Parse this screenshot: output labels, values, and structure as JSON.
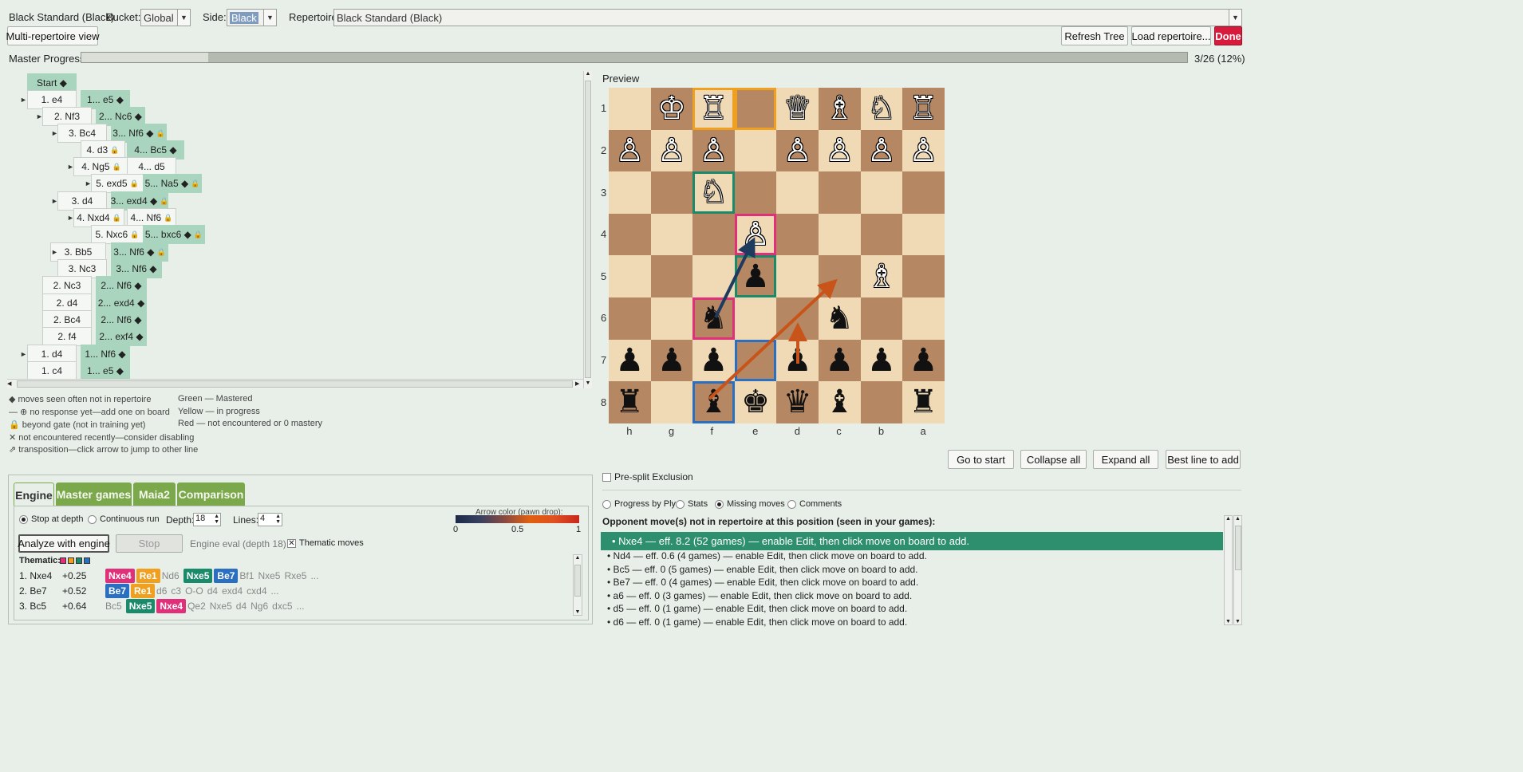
{
  "header": {
    "repertoire_name": "Black Standard (Black)",
    "bucket_label": "Bucket:",
    "bucket_value": "Global",
    "side_label": "Side:",
    "side_value": "Black",
    "repertoire_label": "Repertoire:",
    "repertoire_value": "Black Standard (Black)"
  },
  "toolbar": {
    "multi_view": "Multi-repertoire view",
    "refresh": "Refresh Tree",
    "load": "Load repertoire...",
    "done": "Done"
  },
  "progress": {
    "label": "Master Progress:",
    "text": "3/26 (12%)",
    "fraction": 0.115
  },
  "tree": [
    {
      "label": "Start ◆",
      "kind": "b"
    },
    {
      "label": "1. e4",
      "kind": "w",
      "toggle": true
    },
    {
      "label": "1... e5 ◆",
      "kind": "b"
    },
    {
      "label": "2. Nf3",
      "kind": "w",
      "toggle": true
    },
    {
      "label": "2... Nc6 ◆",
      "kind": "b"
    },
    {
      "label": "3. Bc4",
      "kind": "w",
      "toggle": true
    },
    {
      "label": "3... Nf6 ◆",
      "kind": "b",
      "lock": true
    },
    {
      "label": "4. d3",
      "kind": "w",
      "lock": true
    },
    {
      "label": "4... Bc5 ◆",
      "kind": "b"
    },
    {
      "label": "4. Ng5",
      "kind": "w",
      "lock": true,
      "toggle": true
    },
    {
      "label": "4... d5",
      "kind": "w"
    },
    {
      "label": "5. exd5",
      "kind": "w",
      "lock": true,
      "toggle": true
    },
    {
      "label": "5... Na5 ◆",
      "kind": "b",
      "lock": true
    },
    {
      "label": "3. d4",
      "kind": "w",
      "toggle": true
    },
    {
      "label": "3... exd4 ◆",
      "kind": "b",
      "lock": true
    },
    {
      "label": "4. Nxd4",
      "kind": "w",
      "lock": true,
      "toggle": true
    },
    {
      "label": "4... Nf6",
      "kind": "w",
      "lock": true
    },
    {
      "label": "5. Nxc6",
      "kind": "w",
      "lock": true
    },
    {
      "label": "5... bxc6 ◆",
      "kind": "b",
      "lock": true
    },
    {
      "label": "3. Bb5",
      "kind": "w",
      "toggle": true
    },
    {
      "label": "3... Nf6 ◆",
      "kind": "b",
      "lock": true
    },
    {
      "label": "3. Nc3",
      "kind": "w"
    },
    {
      "label": "3... Nf6 ◆",
      "kind": "b"
    },
    {
      "label": "2. Nc3",
      "kind": "w"
    },
    {
      "label": "2... Nf6 ◆",
      "kind": "b"
    },
    {
      "label": "2. d4",
      "kind": "w"
    },
    {
      "label": "2... exd4 ◆",
      "kind": "b"
    },
    {
      "label": "2. Bc4",
      "kind": "w"
    },
    {
      "label": "2... Nf6 ◆",
      "kind": "b"
    },
    {
      "label": "2. f4",
      "kind": "w"
    },
    {
      "label": "2... exf4 ◆",
      "kind": "b"
    },
    {
      "label": "1. d4",
      "kind": "w",
      "toggle": true
    },
    {
      "label": "1... Nf6 ◆",
      "kind": "b"
    },
    {
      "label": "1. c4",
      "kind": "w"
    },
    {
      "label": "1... e5 ◆",
      "kind": "b"
    }
  ],
  "legend": {
    "left": [
      "◆ moves seen often not in repertoire",
      "— ⊕  no response yet—add one on board",
      "🔒 beyond gate (not in training yet)",
      "✕ not encountered recently—consider disabling",
      "⇗ transposition—click arrow to jump to other line"
    ],
    "right": [
      "Green — Mastered",
      "Yellow — in progress",
      "Red — not encountered or 0 mastery"
    ]
  },
  "preview": {
    "title": "Preview",
    "files": [
      "h",
      "g",
      "f",
      "e",
      "d",
      "c",
      "b",
      "a"
    ],
    "ranks": [
      "1",
      "2",
      "3",
      "4",
      "5",
      "6",
      "7",
      "8"
    ],
    "pieces": [
      [
        "",
        "♔",
        "♖",
        "",
        "♕",
        "♗",
        "♘",
        "♖"
      ],
      [
        "♙",
        "♙",
        "♙",
        "",
        "♙",
        "♙",
        "♙",
        "♙"
      ],
      [
        "",
        "",
        "♘",
        "",
        "",
        "",
        "",
        ""
      ],
      [
        "",
        "",
        "",
        "♙",
        "",
        "",
        "",
        ""
      ],
      [
        "",
        "",
        "",
        "♟",
        "",
        "",
        "♗",
        ""
      ],
      [
        "",
        "",
        "♞",
        "",
        "",
        "♞",
        "",
        ""
      ],
      [
        "♟",
        "♟",
        "♟",
        "",
        "♟",
        "♟",
        "♟",
        "♟"
      ],
      [
        "♜",
        "",
        "♝",
        "♚",
        "♛",
        "♝",
        "",
        "♜"
      ]
    ],
    "highlights": [
      {
        "file": 2,
        "rank": 0,
        "color": "#f0a020"
      },
      {
        "file": 3,
        "rank": 0,
        "color": "#f0a020"
      },
      {
        "file": 2,
        "rank": 2,
        "color": "#1a8a6a"
      },
      {
        "file": 3,
        "rank": 3,
        "color": "#e0307a"
      },
      {
        "file": 3,
        "rank": 4,
        "color": "#1a8a6a"
      },
      {
        "file": 2,
        "rank": 5,
        "color": "#e0307a"
      },
      {
        "file": 3,
        "rank": 6,
        "color": "#2a6fc0"
      },
      {
        "file": 2,
        "rank": 7,
        "color": "#2a6fc0"
      }
    ]
  },
  "board_buttons": {
    "go_start": "Go to start",
    "collapse": "Collapse all",
    "expand": "Expand all",
    "best_line": "Best line to add"
  },
  "pre_split": "Pre-split Exclusion",
  "tabs": [
    "Engine",
    "Master games",
    "Maia2",
    "Comparison"
  ],
  "engine": {
    "stop_at_depth": "Stop at depth",
    "continuous": "Continuous run",
    "depth_label": "Depth:",
    "depth_value": "18",
    "lines_label": "Lines:",
    "lines_value": "4",
    "arrow_color_label": "Arrow color (pawn drop):",
    "scale": [
      "0",
      "0.5",
      "1"
    ],
    "analyze": "Analyze with engine",
    "stop": "Stop",
    "eval_text": "Engine eval (depth 18)",
    "thematic_label": "Thematic moves",
    "thematic_title": "Thematic:",
    "lines": [
      {
        "move": "1. Nxe4",
        "eval": "+0.25",
        "tokens": [
          [
            "Nxe4",
            "#e0307a"
          ],
          [
            "Re1",
            "#f0a020"
          ],
          [
            "Nd6",
            ""
          ],
          [
            "Nxe5",
            "#1a8a6a"
          ],
          [
            "Be7",
            "#2a6fc0"
          ],
          [
            "Bf1",
            ""
          ],
          [
            "Nxe5",
            ""
          ],
          [
            "Rxe5",
            ""
          ],
          [
            "...",
            ""
          ]
        ]
      },
      {
        "move": "2. Be7",
        "eval": "+0.52",
        "tokens": [
          [
            "Be7",
            "#2a6fc0"
          ],
          [
            "Re1",
            "#f0a020"
          ],
          [
            "d6",
            ""
          ],
          [
            "c3",
            ""
          ],
          [
            "O-O",
            ""
          ],
          [
            "d4",
            ""
          ],
          [
            "exd4",
            ""
          ],
          [
            "cxd4",
            ""
          ],
          [
            "...",
            ""
          ]
        ]
      },
      {
        "move": "3. Bc5",
        "eval": "+0.64",
        "tokens": [
          [
            "Bc5",
            ""
          ],
          [
            "Nxe5",
            "#1a8a6a"
          ],
          [
            "Nxe4",
            "#e0307a"
          ],
          [
            "Qe2",
            ""
          ],
          [
            "Nxe5",
            ""
          ],
          [
            "d4",
            ""
          ],
          [
            "Ng6",
            ""
          ],
          [
            "dxc5",
            ""
          ],
          [
            "...",
            ""
          ]
        ]
      }
    ],
    "thematic_colors": [
      "#e0307a",
      "#f0a020",
      "#1a8a6a",
      "#2a6fc0"
    ]
  },
  "right_panel": {
    "radios": [
      "Progress by Ply",
      "Stats",
      "Missing moves",
      "Comments"
    ],
    "selected": 2,
    "heading": "Opponent move(s) not in repertoire at this position (seen in your games):",
    "rows": [
      "• Nxe4 — eff. 8.2 (52 games) — enable Edit, then click move on board to add.",
      "• Nd4 — eff. 0.6 (4 games) — enable Edit, then click move on board to add.",
      "• Bc5 — eff. 0 (5 games) — enable Edit, then click move on board to add.",
      "• Be7 — eff. 0 (4 games) — enable Edit, then click move on board to add.",
      "• a6 — eff. 0 (3 games) — enable Edit, then click move on board to add.",
      "• d5 — eff. 0 (1 game) — enable Edit, then click move on board to add.",
      "• d6 — eff. 0 (1 game) — enable Edit, then click move on board to add."
    ]
  },
  "colors": {
    "accent_green": "#7aa84b",
    "done_red": "#d81b3c",
    "selected_row": "#2e8f6e"
  }
}
